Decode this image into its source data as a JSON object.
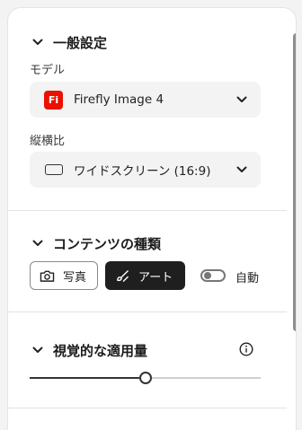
{
  "general": {
    "title": "一般設定",
    "model_label": "モデル",
    "model_value": "Firefly Image 4",
    "model_logo_text": "Fi",
    "ratio_label": "縦横比",
    "ratio_value": "ワイドスクリーン (16:9)"
  },
  "content_type": {
    "title": "コンテンツの種類",
    "photo_label": "写真",
    "art_label": "アート",
    "auto_label": "自動",
    "selected": "アート",
    "auto_enabled": false
  },
  "visual": {
    "title": "視覚的な適用量",
    "slider_value": 0.5
  },
  "colors": {
    "brand_red": "#eb1000",
    "selected_bg": "#1f1f1f"
  }
}
